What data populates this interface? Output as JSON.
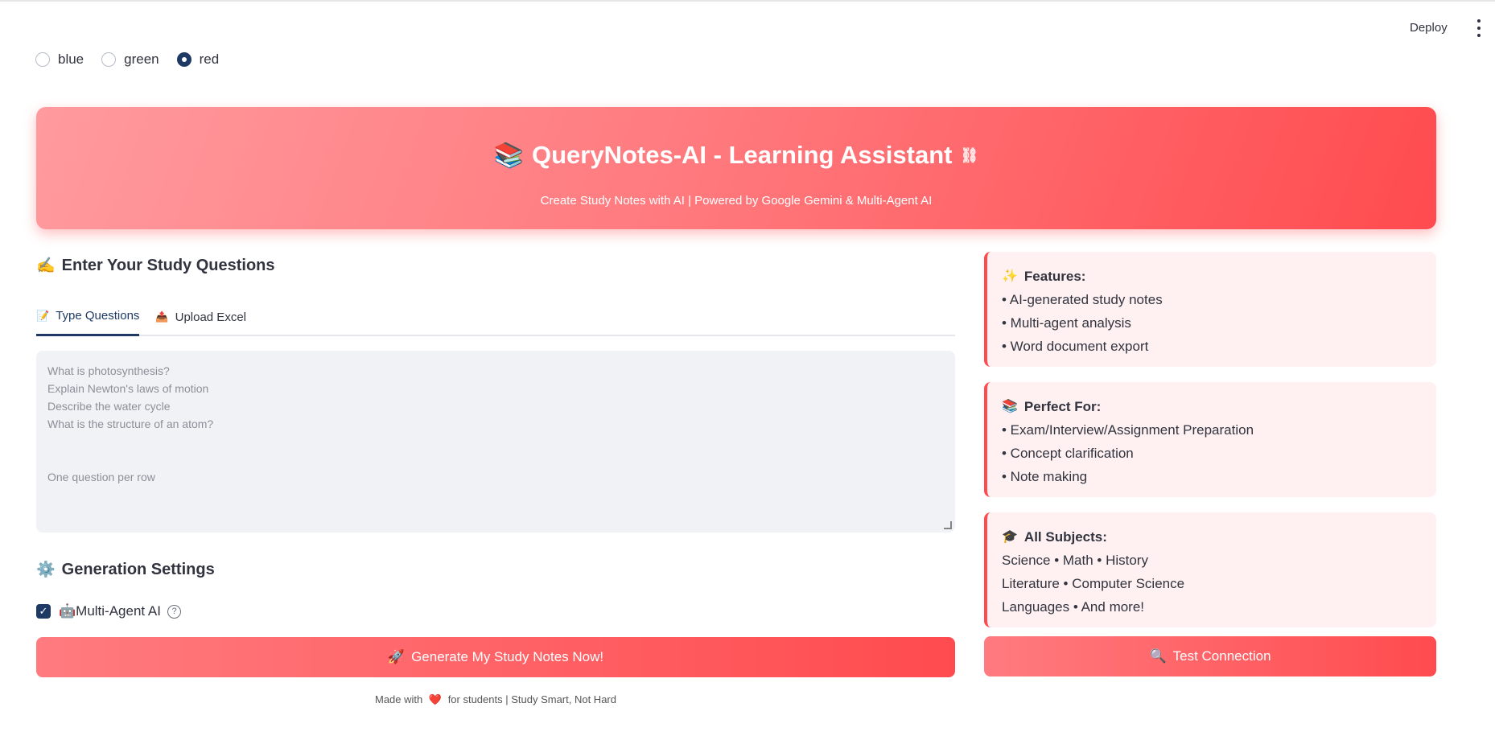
{
  "header": {
    "deploy_label": "Deploy",
    "menu_icon": "kebab-menu-icon"
  },
  "theme_radio": {
    "options": [
      {
        "label": "blue",
        "selected": false
      },
      {
        "label": "green",
        "selected": false
      },
      {
        "label": "red",
        "selected": true
      }
    ]
  },
  "hero": {
    "title": "QueryNotes-AI - Learning Assistant",
    "title_icon": "📚",
    "subtitle": "Create Study Notes with AI | Powered by Google Gemini & Multi-Agent AI",
    "link_icon": "⛓"
  },
  "questions": {
    "title": "Enter Your Study Questions",
    "title_icon": "✍️",
    "tabs": [
      {
        "label": "Type Questions",
        "icon": "📝",
        "active": true
      },
      {
        "label": "Upload Excel",
        "icon": "📤",
        "active": false
      }
    ],
    "placeholder_lines": [
      "What is photosynthesis?",
      "Explain Newton's laws of motion",
      "Describe the water cycle",
      "What is the structure of an atom?"
    ],
    "placeholder_hint": "One question per row"
  },
  "settings": {
    "title": "Generation Settings",
    "title_icon": "⚙️",
    "multi_agent_label": "🤖Multi-Agent AI",
    "multi_agent_checked": true,
    "help_icon": "?"
  },
  "generate_button": {
    "label": "Generate My Study Notes Now!",
    "icon": "🚀"
  },
  "cards": {
    "features": {
      "title": "Features:",
      "icon": "✨",
      "items": [
        "• AI-generated study notes",
        "• Multi-agent analysis",
        "• Word document export"
      ]
    },
    "perfect_for": {
      "title": "Perfect For:",
      "icon": "📚",
      "items": [
        "• Exam/Interview/Assignment Preparation",
        "• Concept clarification",
        "• Note making"
      ]
    },
    "subjects": {
      "title": "All Subjects:",
      "icon": "🎓",
      "items": [
        "Science • Math • History",
        "Literature • Computer Science",
        "Languages • And more!"
      ]
    }
  },
  "test_button": {
    "label": "Test Connection",
    "icon": "🔍"
  },
  "footer": {
    "prefix": "Made with",
    "heart": "❤️",
    "suffix": "for students | Study Smart, Not Hard"
  },
  "colors": {
    "accent": "#ff4b4f",
    "primary": "#1e3a64",
    "card_bg": "#fff1f1",
    "input_bg": "#f0f2f6"
  }
}
